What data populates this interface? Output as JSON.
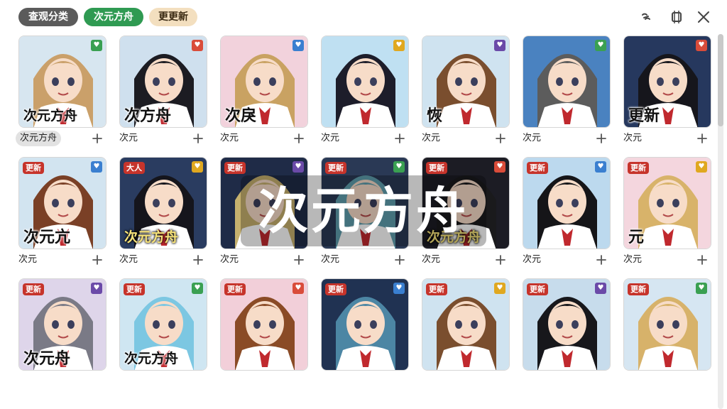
{
  "filters": [
    {
      "label": "查观分类"
    },
    {
      "label": "次元方舟"
    },
    {
      "label": "更更新"
    }
  ],
  "window_controls": [
    {
      "icon": "link-icon"
    },
    {
      "icon": "window-icon"
    },
    {
      "icon": "close-icon"
    }
  ],
  "watermark": "次元方舟",
  "colors": {
    "chip_dark": "#5b5b5b",
    "chip_green": "#2f9a52",
    "chip_cream": "#f3dfbf",
    "badge_red": "#c6342b"
  },
  "cards": [
    {
      "caption": "次元方舟",
      "badge": "",
      "overlay": "次元方舟",
      "hair": "#caa06a",
      "bg": "#d7e6f0"
    },
    {
      "caption": "次元",
      "badge": "",
      "overlay": "次方舟",
      "hair": "#1c1c22",
      "bg": "#cfe0ee"
    },
    {
      "caption": "次元",
      "badge": "",
      "overlay": "次戾",
      "hair": "#c9a262",
      "bg": "#f2d2dc"
    },
    {
      "caption": "次元",
      "badge": "",
      "overlay": "",
      "hair": "#1d1d2a",
      "bg": "#bfe0f2"
    },
    {
      "caption": "次元",
      "badge": "",
      "overlay": "恢",
      "hair": "#7a4e2e",
      "bg": "#cfe3f0"
    },
    {
      "caption": "次元",
      "badge": "",
      "overlay": "",
      "hair": "#5c5c5c",
      "bg": "#4a82c0"
    },
    {
      "caption": "次元",
      "badge": "",
      "overlay": "更新",
      "hair": "#16161c",
      "bg": "#26385e"
    },
    {
      "caption": "次元",
      "badge": "更新",
      "overlay": "次元亢",
      "hair": "#7a4026",
      "bg": "#d2e4f0"
    },
    {
      "caption": "次元",
      "badge": "大人",
      "overlay": "次元方舟",
      "hair": "#15151c",
      "bg": "#2a3c60"
    },
    {
      "caption": "次元",
      "badge": "更新",
      "overlay": "",
      "hair": "#c6b16e",
      "bg": "#1f2b47"
    },
    {
      "caption": "次元",
      "badge": "更新",
      "overlay": "",
      "hair": "#5f9fae",
      "bg": "#2a3955"
    },
    {
      "caption": "次元",
      "badge": "更新",
      "overlay": "次元方舟",
      "hair": "#1a1a1c",
      "bg": "#1c1c24"
    },
    {
      "caption": "次元",
      "badge": "更新",
      "overlay": "",
      "hair": "#151518",
      "bg": "#bcd9ee"
    },
    {
      "caption": "次元",
      "badge": "更新",
      "overlay": "元",
      "hair": "#d8b36a",
      "bg": "#f4d6de"
    },
    {
      "caption": "",
      "badge": "更新",
      "overlay": "次元舟",
      "hair": "#7a7a86",
      "bg": "#ded5ea"
    },
    {
      "caption": "",
      "badge": "更新",
      "overlay": "次元方舟",
      "hair": "#7cc7e2",
      "bg": "#cfe6f2"
    },
    {
      "caption": "",
      "badge": "更新",
      "overlay": "",
      "hair": "#8a4b26",
      "bg": "#f2cfd9"
    },
    {
      "caption": "",
      "badge": "更新",
      "overlay": "",
      "hair": "#4c86a4",
      "bg": "#203252"
    },
    {
      "caption": "",
      "badge": "更新",
      "overlay": "",
      "hair": "#7a4e2e",
      "bg": "#cfe3f0"
    },
    {
      "caption": "",
      "badge": "更新",
      "overlay": "",
      "hair": "#17171b",
      "bg": "#c7dcec"
    },
    {
      "caption": "",
      "badge": "更新",
      "overlay": "",
      "hair": "#d7b26a",
      "bg": "#d6e6f2"
    }
  ]
}
